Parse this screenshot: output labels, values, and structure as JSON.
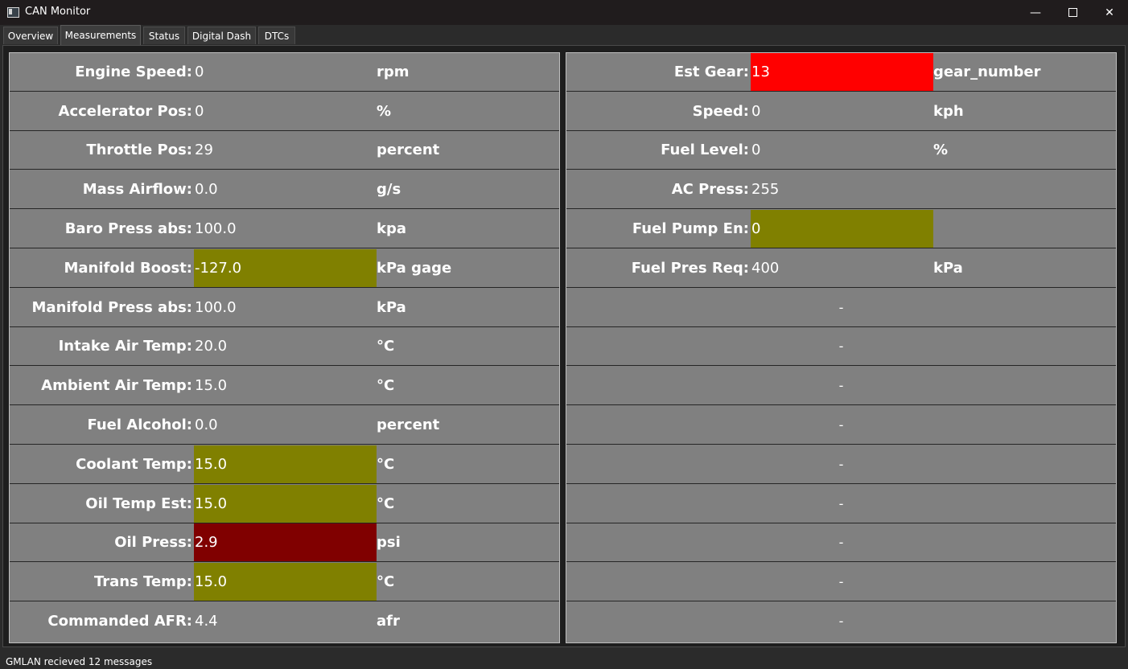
{
  "window": {
    "title": "CAN Monitor",
    "minimize": "—",
    "close": "✕"
  },
  "tabs": [
    "Overview",
    "Measurements",
    "Status",
    "Digital Dash",
    "DTCs"
  ],
  "colors": {
    "warn": "#808000",
    "alert": "#ff0000",
    "danger": "#800000"
  },
  "left": [
    {
      "label": "Engine Speed:",
      "value": "0",
      "unit": "rpm"
    },
    {
      "label": "Accelerator Pos:",
      "value": "0",
      "unit": "%"
    },
    {
      "label": "Throttle Pos:",
      "value": "29",
      "unit": "percent"
    },
    {
      "label": "Mass Airflow:",
      "value": "0.0",
      "unit": "g/s"
    },
    {
      "label": "Baro Press abs:",
      "value": "100.0",
      "unit": "kpa"
    },
    {
      "label": "Manifold Boost:",
      "value": "-127.0",
      "unit": "kPa gage",
      "bg": "#808000"
    },
    {
      "label": "Manifold Press abs:",
      "value": "100.0",
      "unit": "kPa"
    },
    {
      "label": "Intake Air Temp:",
      "value": "20.0",
      "unit": "°C"
    },
    {
      "label": "Ambient Air Temp:",
      "value": "15.0",
      "unit": "°C"
    },
    {
      "label": "Fuel Alcohol:",
      "value": "0.0",
      "unit": "percent"
    },
    {
      "label": "Coolant Temp:",
      "value": "15.0",
      "unit": "°C",
      "bg": "#808000"
    },
    {
      "label": "Oil Temp Est:",
      "value": "15.0",
      "unit": "°C",
      "bg": "#808000"
    },
    {
      "label": "Oil Press:",
      "value": "2.9",
      "unit": "psi",
      "bg": "#800000"
    },
    {
      "label": "Trans Temp:",
      "value": "15.0",
      "unit": "°C",
      "bg": "#808000"
    },
    {
      "label": "Commanded AFR:",
      "value": "4.4",
      "unit": "afr"
    }
  ],
  "right": [
    {
      "label": "Est Gear:",
      "value": "13",
      "unit": "gear_number",
      "bg": "#ff0000"
    },
    {
      "label": "Speed:",
      "value": "0",
      "unit": "kph"
    },
    {
      "label": "Fuel Level:",
      "value": "0",
      "unit": "%"
    },
    {
      "label": "AC Press:",
      "value": "255",
      "unit": ""
    },
    {
      "label": "Fuel Pump En:",
      "value": "0",
      "unit": "",
      "bg": "#808000"
    },
    {
      "label": "Fuel Pres Req:",
      "value": "400",
      "unit": "kPa"
    },
    {
      "empty": "-"
    },
    {
      "empty": "-"
    },
    {
      "empty": "-"
    },
    {
      "empty": "-"
    },
    {
      "empty": "-"
    },
    {
      "empty": "-"
    },
    {
      "empty": "-"
    },
    {
      "empty": "-"
    },
    {
      "empty": "-"
    }
  ],
  "status": {
    "text": "GMLAN recieved 12 messages"
  }
}
